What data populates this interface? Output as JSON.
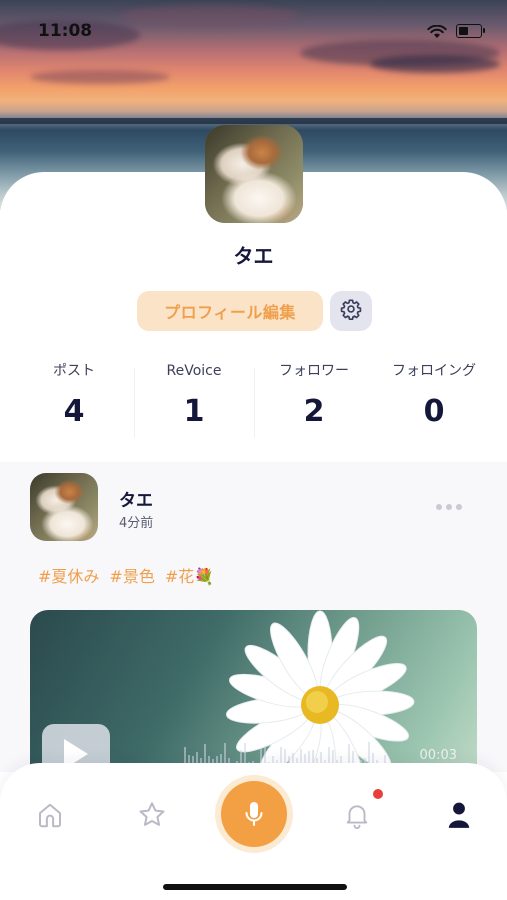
{
  "status_bar": {
    "time": "11:08"
  },
  "profile": {
    "name": "タエ",
    "edit_button_label": "プロフィール編集"
  },
  "stats": [
    {
      "label": "ポスト",
      "value": "4"
    },
    {
      "label": "ReVoice",
      "value": "1"
    },
    {
      "label": "フォロワー",
      "value": "2"
    },
    {
      "label": "フォロイング",
      "value": "0"
    }
  ],
  "post": {
    "author": "タエ",
    "time_ago": "4分前",
    "tags": [
      "#夏休み",
      "#景色",
      "#花💐"
    ],
    "media": {
      "duration": "00:03"
    }
  },
  "tabbar": {
    "items": [
      "home-icon",
      "star-icon",
      "mic-icon",
      "bell-icon",
      "profile-icon"
    ],
    "active": "profile-icon",
    "notification_dot": true
  },
  "colors": {
    "accent": "#f2a043",
    "accent_light": "#fbe3c7",
    "text_dark": "#15173a",
    "badge": "#e5403b"
  }
}
